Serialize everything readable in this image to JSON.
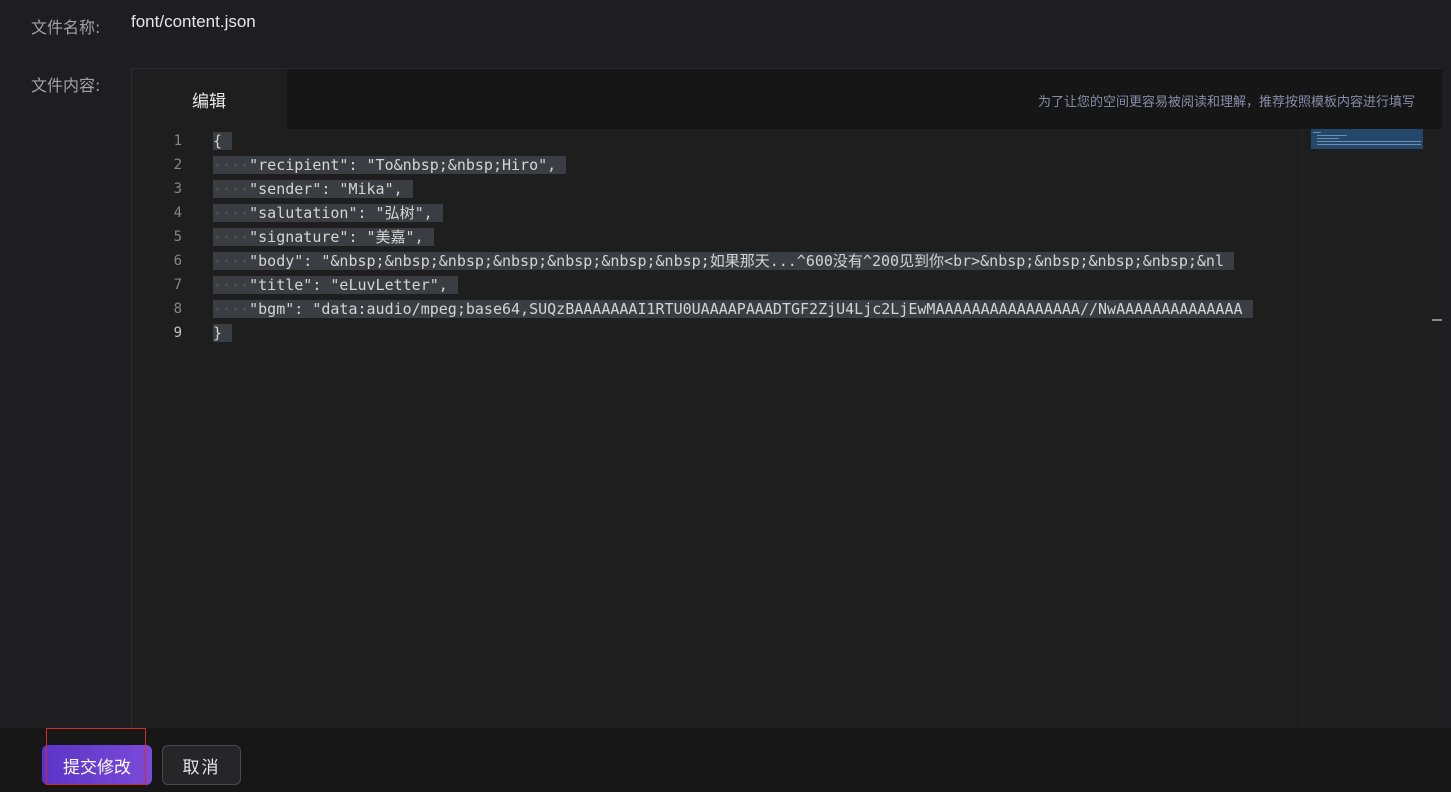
{
  "form": {
    "filename_label": "文件名称:",
    "filename_value": "font/content.json",
    "content_label": "文件内容:"
  },
  "editor": {
    "tab_label": "编辑",
    "hint": "为了让您的空间更容易被阅读和理解，推荐按照模板内容进行填写",
    "line_numbers": [
      "1",
      "2",
      "3",
      "4",
      "5",
      "6",
      "7",
      "8",
      "9"
    ],
    "lines": [
      {
        "indent": "",
        "text": "{"
      },
      {
        "indent": "····",
        "text": "\"recipient\": \"To&nbsp;&nbsp;Hiro\","
      },
      {
        "indent": "····",
        "text": "\"sender\": \"Mika\","
      },
      {
        "indent": "····",
        "text": "\"salutation\": \"弘树\","
      },
      {
        "indent": "····",
        "text": "\"signature\": \"美嘉\","
      },
      {
        "indent": "····",
        "text": "\"body\": \"&nbsp;&nbsp;&nbsp;&nbsp;&nbsp;&nbsp;&nbsp;如果那天...^600没有^200见到你<br>&nbsp;&nbsp;&nbsp;&nbsp;&nl"
      },
      {
        "indent": "····",
        "text": "\"title\": \"eLuvLetter\","
      },
      {
        "indent": "····",
        "text": "\"bgm\": \"data:audio/mpeg;base64,SUQzBAAAAAAAI1RTU0UAAAAPAAADTGF2ZjU4Ljc2LjEwMAAAAAAAAAAAAAAAA//NwAAAAAAAAAAAAAA"
      },
      {
        "indent": "",
        "text": "}"
      }
    ]
  },
  "actions": {
    "submit_label": "提交修改",
    "cancel_label": "取消"
  },
  "colors": {
    "background": "#1e1e20",
    "accent": "#6a3fd0",
    "highlight_outline": "#d22b2b",
    "selection": "#3a3d41"
  }
}
